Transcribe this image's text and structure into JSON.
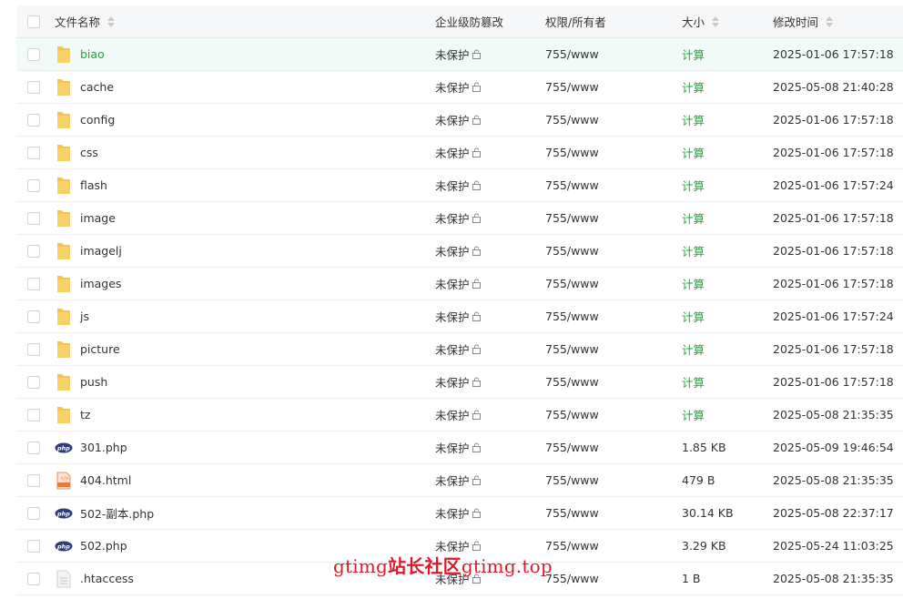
{
  "header": {
    "name": "文件名称",
    "protection": "企业级防篡改",
    "permission": "权限/所有者",
    "size": "大小",
    "modified": "修改时间"
  },
  "files": [
    {
      "name": "biao",
      "type": "folder",
      "protection": "未保护",
      "permission": "755/www",
      "size": "计算",
      "size_is_link": true,
      "modified": "2025-01-06 17:57:18"
    },
    {
      "name": "cache",
      "type": "folder",
      "protection": "未保护",
      "permission": "755/www",
      "size": "计算",
      "size_is_link": true,
      "modified": "2025-05-08 21:40:28"
    },
    {
      "name": "config",
      "type": "folder",
      "protection": "未保护",
      "permission": "755/www",
      "size": "计算",
      "size_is_link": true,
      "modified": "2025-01-06 17:57:18"
    },
    {
      "name": "css",
      "type": "folder",
      "protection": "未保护",
      "permission": "755/www",
      "size": "计算",
      "size_is_link": true,
      "modified": "2025-01-06 17:57:18"
    },
    {
      "name": "flash",
      "type": "folder",
      "protection": "未保护",
      "permission": "755/www",
      "size": "计算",
      "size_is_link": true,
      "modified": "2025-01-06 17:57:24"
    },
    {
      "name": "image",
      "type": "folder",
      "protection": "未保护",
      "permission": "755/www",
      "size": "计算",
      "size_is_link": true,
      "modified": "2025-01-06 17:57:18"
    },
    {
      "name": "imagelj",
      "type": "folder",
      "protection": "未保护",
      "permission": "755/www",
      "size": "计算",
      "size_is_link": true,
      "modified": "2025-01-06 17:57:18"
    },
    {
      "name": "images",
      "type": "folder",
      "protection": "未保护",
      "permission": "755/www",
      "size": "计算",
      "size_is_link": true,
      "modified": "2025-01-06 17:57:18"
    },
    {
      "name": "js",
      "type": "folder",
      "protection": "未保护",
      "permission": "755/www",
      "size": "计算",
      "size_is_link": true,
      "modified": "2025-01-06 17:57:24"
    },
    {
      "name": "picture",
      "type": "folder",
      "protection": "未保护",
      "permission": "755/www",
      "size": "计算",
      "size_is_link": true,
      "modified": "2025-01-06 17:57:18"
    },
    {
      "name": "push",
      "type": "folder",
      "protection": "未保护",
      "permission": "755/www",
      "size": "计算",
      "size_is_link": true,
      "modified": "2025-01-06 17:57:18"
    },
    {
      "name": "tz",
      "type": "folder",
      "protection": "未保护",
      "permission": "755/www",
      "size": "计算",
      "size_is_link": true,
      "modified": "2025-05-08 21:35:35"
    },
    {
      "name": "301.php",
      "type": "php",
      "protection": "未保护",
      "permission": "755/www",
      "size": "1.85 KB",
      "size_is_link": false,
      "modified": "2025-05-09 19:46:54"
    },
    {
      "name": "404.html",
      "type": "html",
      "protection": "未保护",
      "permission": "755/www",
      "size": "479 B",
      "size_is_link": false,
      "modified": "2025-05-08 21:35:35"
    },
    {
      "name": "502-副本.php",
      "type": "php",
      "protection": "未保护",
      "permission": "755/www",
      "size": "30.14 KB",
      "size_is_link": false,
      "modified": "2025-05-08 22:37:17"
    },
    {
      "name": "502.php",
      "type": "php",
      "protection": "未保护",
      "permission": "755/www",
      "size": "3.29 KB",
      "size_is_link": false,
      "modified": "2025-05-24 11:03:25"
    },
    {
      "name": ".htaccess",
      "type": "text",
      "protection": "未保护",
      "permission": "755/www",
      "size": "1 B",
      "size_is_link": false,
      "modified": "2025-05-08 21:35:35"
    }
  ],
  "selected_index": 0,
  "watermark": {
    "part1": "gtimg",
    "part2": "站长社区",
    "part3": "gtimg.top"
  },
  "colors": {
    "accent_green": "#20a53a",
    "folder_yellow": "#f5c64f",
    "php_navy": "#2e3b79",
    "html_orange": "#e87a3b",
    "watermark_red": "#e0192a"
  }
}
